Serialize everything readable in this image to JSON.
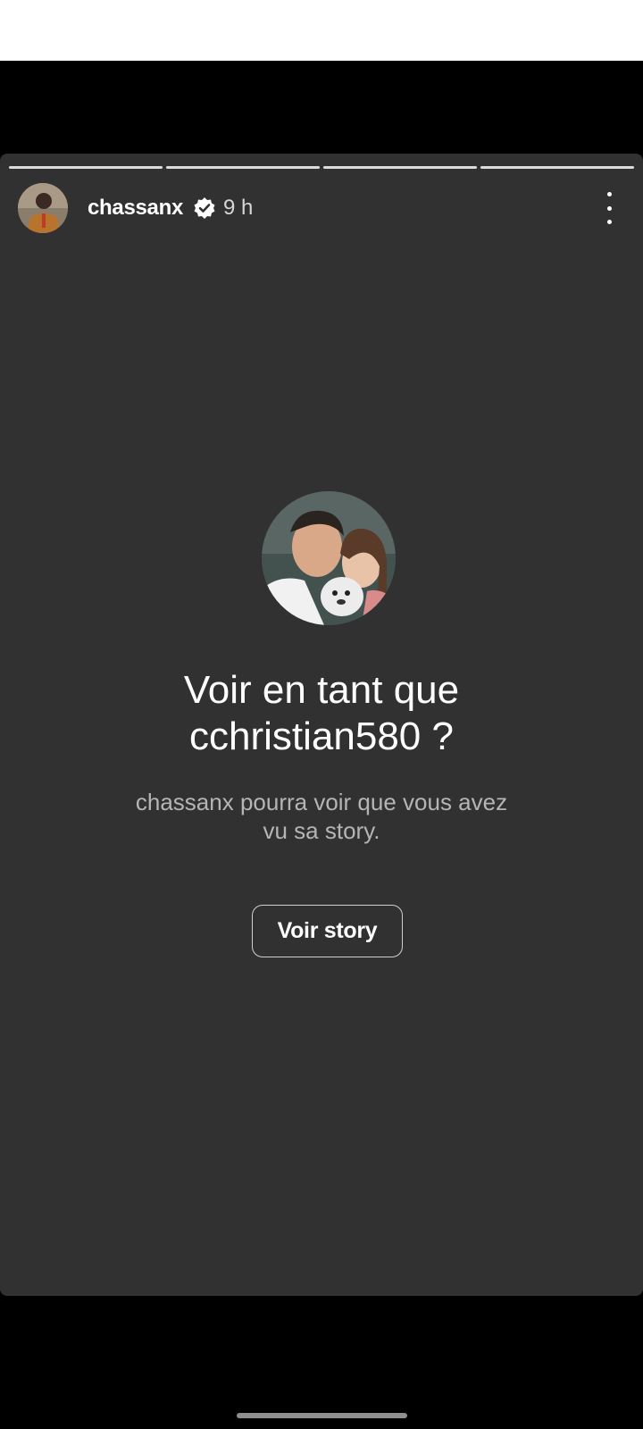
{
  "story": {
    "segments_progress": [
      1,
      1,
      1,
      1
    ],
    "author": {
      "username": "chassanx",
      "verified": true,
      "time_ago": "9 h"
    }
  },
  "prompt": {
    "title_line1": "Voir en tant que",
    "title_line2": "cchristian580 ?",
    "subtitle_line1": "chassanx pourra voir que vous avez",
    "subtitle_line2": "vu sa story.",
    "button_label": "Voir story"
  },
  "icons": {
    "verified": "verified-badge-icon",
    "more": "more-vertical-icon"
  },
  "colors": {
    "card_background": "#313131",
    "text_primary": "#ffffff",
    "text_secondary": "#b5b5b5",
    "button_border": "#cfcfcf"
  }
}
